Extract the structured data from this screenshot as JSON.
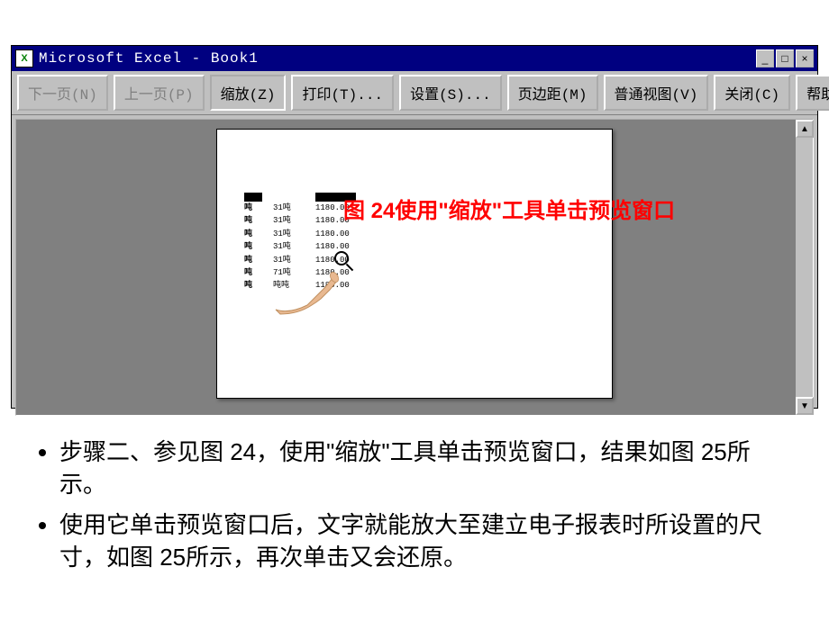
{
  "window": {
    "title": "Microsoft Excel - Book1",
    "controls": {
      "minimize": "_",
      "maximize": "□",
      "close": "×"
    }
  },
  "toolbar": {
    "next": "下一页(N)",
    "prev": "上一页(P)",
    "zoom": "缩放(Z)",
    "print": "打印(T)...",
    "setup": "设置(S)...",
    "margins": "页边距(M)",
    "normal": "普通视图(V)",
    "close": "关闭(C)",
    "help": "帮助(H)"
  },
  "annotation": "图 24使用\"缩放\"工具单击预览窗口",
  "preview": {
    "rows": [
      [
        "■",
        "",
        "■"
      ],
      [
        "吨",
        "31吨",
        "1180.00"
      ],
      [
        "吨",
        "31吨",
        "1180.00"
      ],
      [
        "吨",
        "31吨",
        "1180.00"
      ],
      [
        "吨",
        "31吨",
        "1180.00"
      ],
      [
        "吨",
        "31吨",
        "1180.00"
      ],
      [
        "吨",
        "71吨",
        "1180.00"
      ],
      [
        "吨",
        "吨吨",
        "1180.00"
      ]
    ]
  },
  "scrollbar": {
    "up": "▲",
    "down": "▼"
  },
  "bullets": [
    "步骤二、参见图 24，使用\"缩放\"工具单击预览窗口，结果如图 25所示。",
    "使用它单击预览窗口后，文字就能放大至建立电子报表时所设置的尺寸，如图 25所示，再次单击又会还原。"
  ]
}
